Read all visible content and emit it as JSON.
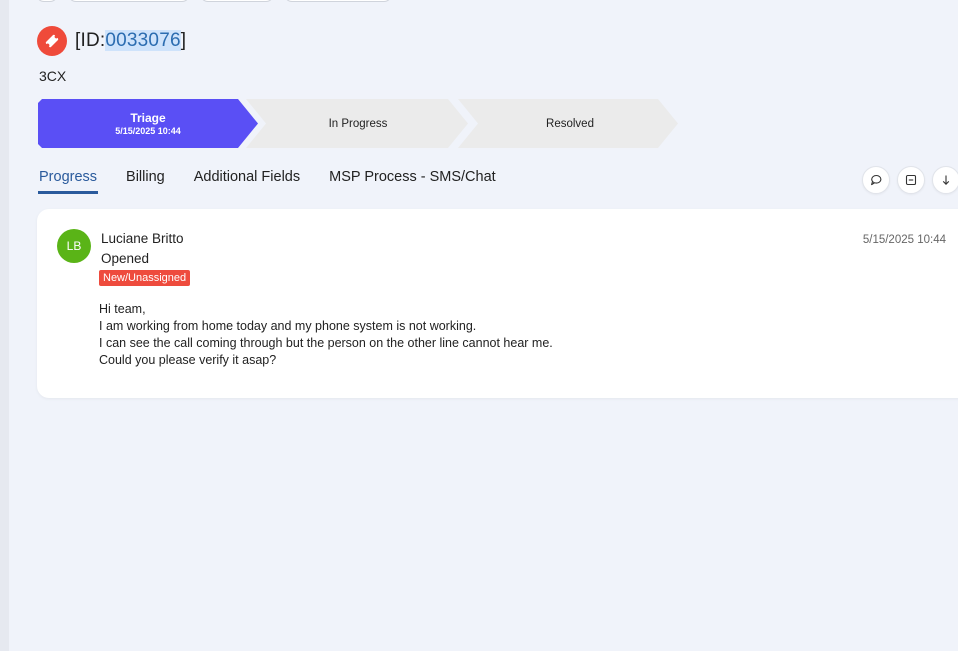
{
  "ticket": {
    "id_prefix": "[ID:",
    "id_number": "0033076",
    "id_suffix": "]",
    "subtitle": "3CX"
  },
  "stages": [
    {
      "label": "Triage",
      "date": "5/15/2025 10:44",
      "active": true
    },
    {
      "label": "In Progress",
      "date": "",
      "active": false
    },
    {
      "label": "Resolved",
      "date": "",
      "active": false
    }
  ],
  "tabs": [
    {
      "label": "Progress",
      "active": true
    },
    {
      "label": "Billing",
      "active": false
    },
    {
      "label": "Additional Fields",
      "active": false
    },
    {
      "label": "MSP Process - SMS/Chat",
      "active": false
    }
  ],
  "tab_actions": [
    {
      "icon": "comment-icon"
    },
    {
      "icon": "collapse-icon"
    },
    {
      "icon": "arrow-down-icon"
    }
  ],
  "entry": {
    "initials": "LB",
    "author": "Luciane Britto",
    "action": "Opened",
    "status_badge": "New/Unassigned",
    "timestamp": "5/15/2025 10:44",
    "message_lines": [
      "Hi team,",
      "I am working from home today and my phone system is not working.",
      "I can see the call coming through but the person on the other line cannot hear me.",
      "Could you please verify it asap?"
    ]
  },
  "colors": {
    "active_stage": "#5a4ff5",
    "inactive_stage": "#ebebeb",
    "accent_tab": "#2a5a9c",
    "badge_red": "#ee4b3d",
    "avatar_green": "#5ab417",
    "ticket_icon": "#ef4a3a"
  }
}
